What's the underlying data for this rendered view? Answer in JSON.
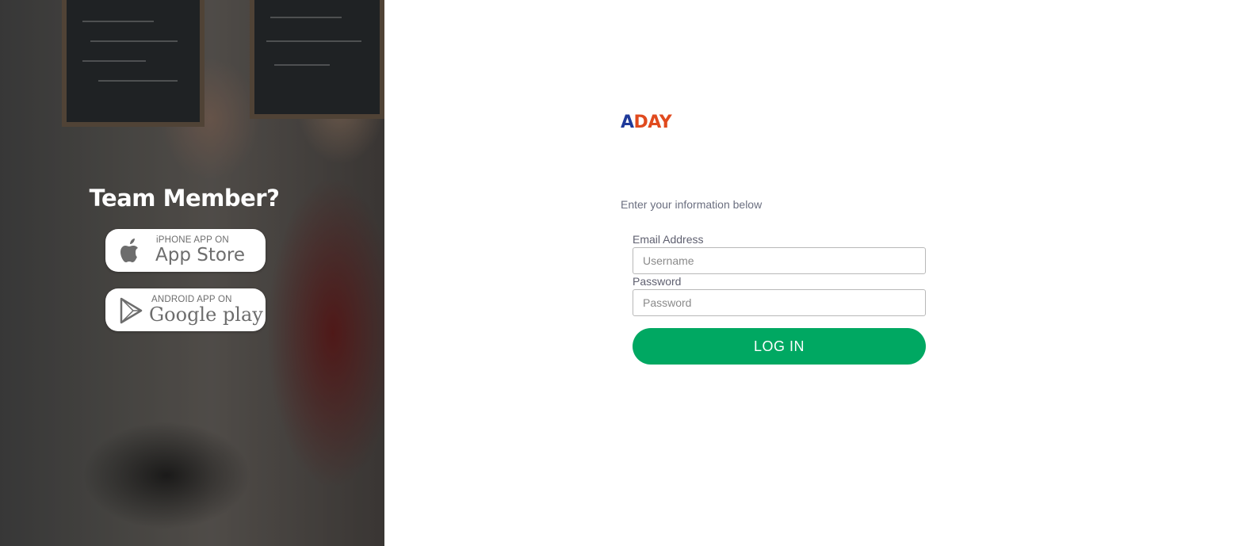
{
  "sidebar": {
    "title": "Team Member?",
    "app_store": {
      "small": "iPHONE APP ON",
      "big": "App Store",
      "icon": "apple-icon"
    },
    "google_play": {
      "small": "ANDROID APP ON",
      "big": "Google play",
      "icon": "play-icon"
    }
  },
  "brand": {
    "logo_part1": "A",
    "logo_part2": "DAY",
    "color_a": "#1f3a9a",
    "color_rest": "#e04a1e"
  },
  "form": {
    "intro": "Enter your information below",
    "email_label": "Email Address",
    "email_placeholder": "Username",
    "password_label": "Password",
    "password_placeholder": "Password",
    "login_label": "LOG IN",
    "login_color": "#00a862"
  }
}
